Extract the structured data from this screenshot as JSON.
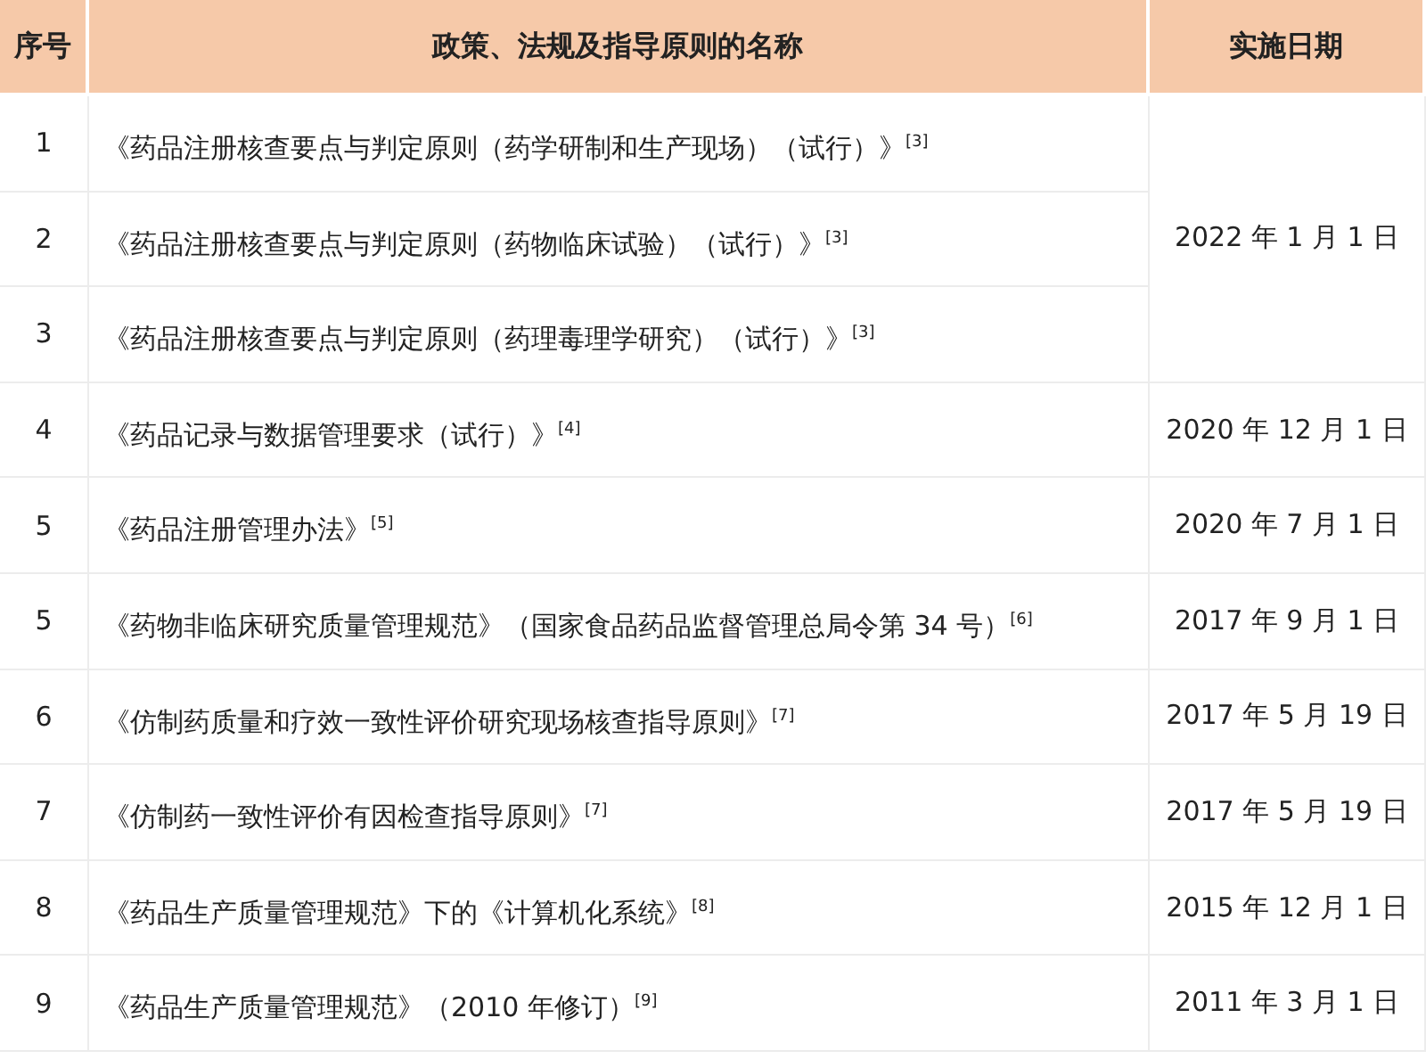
{
  "columns": [
    "序号",
    "政策、法规及指导原则的名称",
    "实施日期"
  ],
  "groups": [
    {
      "date": "2022 年 1 月 1 日",
      "rows": [
        {
          "number": "1",
          "name": "《药品注册核查要点与判定原则（药学研制和生产现场）（试行）》$^{[3]}$"
        },
        {
          "number": "2",
          "name": "《药品注册核查要点与判定原则（药物临床试验）（试行）》$^{[3]}$"
        },
        {
          "number": "3",
          "name": "《药品注册核查要点与判定原则（药理毒理学研究）（试行）》$^{[3]}$"
        }
      ]
    },
    {
      "date": "2020 年 12 月 1 日",
      "rows": [
        {
          "number": "4",
          "name": "《药品记录与数据管理要求（试行）》$^{[4]}$"
        }
      ]
    },
    {
      "date": "2020 年 7 月 1 日",
      "rows": [
        {
          "number": "5",
          "name": "《药品注册管理办法》$^{[5]}$"
        }
      ]
    },
    {
      "date": "2017 年 9 月 1 日",
      "rows": [
        {
          "number": "5",
          "name": "《药物非临床研究质量管理规范》（国家食品药品监督管理总局令第 34 号）$^{[6]}$"
        }
      ]
    },
    {
      "date": "2017 年 5 月 19 日",
      "rows": [
        {
          "number": "6",
          "name": "《仿制药质量和疗效一致性评价研究现场核查指导原则》$^{[7]}$"
        }
      ]
    },
    {
      "date": "2017 年 5 月 19 日",
      "rows": [
        {
          "number": "7",
          "name": "《仿制药一致性评价有因检查指导原则》$^{[7]}$"
        }
      ]
    },
    {
      "date": "2015 年 12 月 1 日",
      "rows": [
        {
          "number": "8",
          "name": "《药品生产质量管理规范》下的《计算机化系统》$^{[8]}$"
        }
      ]
    },
    {
      "date": "2011 年 3 月 1 日",
      "rows": [
        {
          "number": "9",
          "name": "《药品生产质量管理规范》（2010 年修订）$^{[9]}$"
        }
      ]
    }
  ]
}
